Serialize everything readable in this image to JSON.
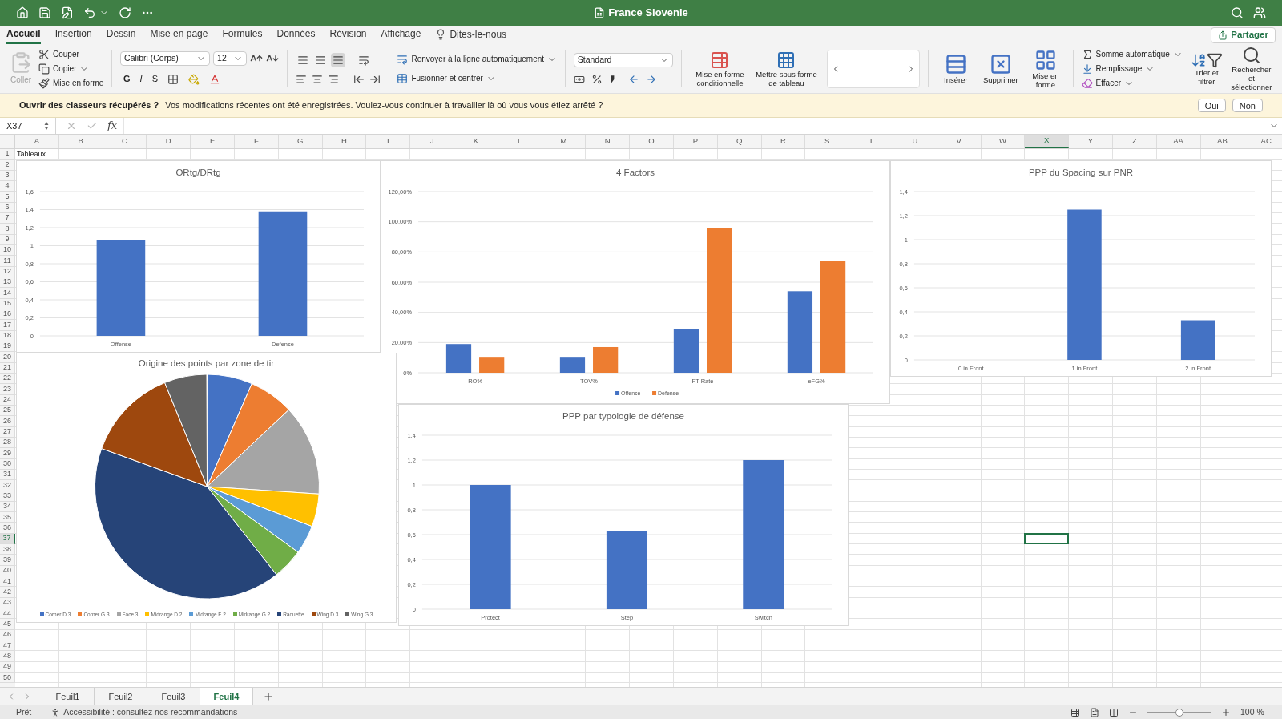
{
  "window": {
    "title": "France Slovenie"
  },
  "menu_tabs": [
    {
      "label": "Accueil",
      "selected": true
    },
    {
      "label": "Insertion",
      "selected": false
    },
    {
      "label": "Dessin",
      "selected": false
    },
    {
      "label": "Mise en page",
      "selected": false
    },
    {
      "label": "Formules",
      "selected": false
    },
    {
      "label": "Données",
      "selected": false
    },
    {
      "label": "Révision",
      "selected": false
    },
    {
      "label": "Affichage",
      "selected": false
    }
  ],
  "tell_me": "Dites-le-nous",
  "share": "Partager",
  "ribbon": {
    "clipboard": {
      "paste": {
        "label": "Coller",
        "disabled": true
      },
      "cut": "Couper",
      "copy": "Copier",
      "format_painter": "Mise en forme"
    },
    "font": {
      "name": "Calibri (Corps)",
      "size": "12",
      "bold": "G",
      "italic": "I",
      "underline": "S"
    },
    "alignment": {
      "vertical": [
        {
          "selected": false
        },
        {
          "selected": false
        },
        {
          "selected": true
        }
      ],
      "wrap": "Renvoyer à la ligne automatiquement",
      "merge": "Fusionner et centrer"
    },
    "number": {
      "format": "Standard"
    },
    "styles": [
      "Mise en forme conditionnelle",
      "Mettre sous forme de tableau"
    ],
    "cells": [
      "Insérer",
      "Supprimer",
      "Mise en forme"
    ],
    "editing": {
      "autosum": "Somme automatique",
      "fill": "Remplissage",
      "clear": "Effacer",
      "sort": "Trier et filtrer",
      "find": "Rechercher et sélectionner"
    }
  },
  "notification": {
    "title": "Ouvrir des classeurs récupérés ?",
    "message": "Vos modifications récentes ont été enregistrées. Voulez-vous continuer à travailler là où vous vous étiez arrêté ?",
    "buttons": [
      "Oui",
      "Non"
    ]
  },
  "formula_bar": {
    "name_box": "X37",
    "function_label": "fx"
  },
  "columns": [
    {
      "label": "A",
      "selected": false
    },
    {
      "label": "B",
      "selected": false
    },
    {
      "label": "C",
      "selected": false
    },
    {
      "label": "D",
      "selected": false
    },
    {
      "label": "E",
      "selected": false
    },
    {
      "label": "F",
      "selected": false
    },
    {
      "label": "G",
      "selected": false
    },
    {
      "label": "H",
      "selected": false
    },
    {
      "label": "I",
      "selected": false
    },
    {
      "label": "J",
      "selected": false
    },
    {
      "label": "K",
      "selected": false
    },
    {
      "label": "L",
      "selected": false
    },
    {
      "label": "M",
      "selected": false
    },
    {
      "label": "N",
      "selected": false
    },
    {
      "label": "O",
      "selected": false
    },
    {
      "label": "P",
      "selected": false
    },
    {
      "label": "Q",
      "selected": false
    },
    {
      "label": "R",
      "selected": false
    },
    {
      "label": "S",
      "selected": false
    },
    {
      "label": "T",
      "selected": false
    },
    {
      "label": "U",
      "selected": false
    },
    {
      "label": "V",
      "selected": false
    },
    {
      "label": "W",
      "selected": false
    },
    {
      "label": "X",
      "selected": true
    },
    {
      "label": "Y",
      "selected": false
    },
    {
      "label": "Z",
      "selected": false
    },
    {
      "label": "AA",
      "selected": false
    },
    {
      "label": "AB",
      "selected": false
    },
    {
      "label": "AC",
      "selected": false
    }
  ],
  "rows": [
    {
      "label": "1",
      "selected": false
    },
    {
      "label": "2",
      "selected": false
    },
    {
      "label": "3",
      "selected": false
    },
    {
      "label": "4",
      "selected": false
    },
    {
      "label": "5",
      "selected": false
    },
    {
      "label": "6",
      "selected": false
    },
    {
      "label": "7",
      "selected": false
    },
    {
      "label": "8",
      "selected": false
    },
    {
      "label": "9",
      "selected": false
    },
    {
      "label": "10",
      "selected": false
    },
    {
      "label": "11",
      "selected": false
    },
    {
      "label": "12",
      "selected": false
    },
    {
      "label": "13",
      "selected": false
    },
    {
      "label": "14",
      "selected": false
    },
    {
      "label": "15",
      "selected": false
    },
    {
      "label": "16",
      "selected": false
    },
    {
      "label": "17",
      "selected": false
    },
    {
      "label": "18",
      "selected": false
    },
    {
      "label": "19",
      "selected": false
    },
    {
      "label": "20",
      "selected": false
    },
    {
      "label": "21",
      "selected": false
    },
    {
      "label": "22",
      "selected": false
    },
    {
      "label": "23",
      "selected": false
    },
    {
      "label": "24",
      "selected": false
    },
    {
      "label": "25",
      "selected": false
    },
    {
      "label": "26",
      "selected": false
    },
    {
      "label": "27",
      "selected": false
    },
    {
      "label": "28",
      "selected": false
    },
    {
      "label": "29",
      "selected": false
    },
    {
      "label": "30",
      "selected": false
    },
    {
      "label": "31",
      "selected": false
    },
    {
      "label": "32",
      "selected": false
    },
    {
      "label": "33",
      "selected": false
    },
    {
      "label": "34",
      "selected": false
    },
    {
      "label": "35",
      "selected": false
    },
    {
      "label": "36",
      "selected": false
    },
    {
      "label": "37",
      "selected": true
    },
    {
      "label": "38",
      "selected": false
    },
    {
      "label": "39",
      "selected": false
    },
    {
      "label": "40",
      "selected": false
    },
    {
      "label": "41",
      "selected": false
    },
    {
      "label": "42",
      "selected": false
    },
    {
      "label": "43",
      "selected": false
    },
    {
      "label": "44",
      "selected": false
    },
    {
      "label": "45",
      "selected": false
    },
    {
      "label": "46",
      "selected": false
    },
    {
      "label": "47",
      "selected": false
    },
    {
      "label": "48",
      "selected": false
    },
    {
      "label": "49",
      "selected": false
    },
    {
      "label": "50",
      "selected": false
    }
  ],
  "cells": [
    {
      "text": "Tableaux"
    }
  ],
  "charts": [
    {
      "kind": "bar",
      "chart_data": {
        "type": "bar",
        "grid": true,
        "title": "ORtg/DRtg",
        "categories": [
          "Offense",
          "Defense"
        ],
        "values": [
          1.06,
          1.38
        ],
        "ylim": [
          0,
          1.6
        ],
        "yticks": [
          {
            "value": 0,
            "label": "0"
          },
          {
            "value": 0.2,
            "label": "0,2"
          },
          {
            "value": 0.4,
            "label": "0,4"
          },
          {
            "value": 0.6,
            "label": "0,6"
          },
          {
            "value": 0.8,
            "label": "0,8"
          },
          {
            "value": 1,
            "label": "1"
          },
          {
            "value": 1.2,
            "label": "1,2"
          },
          {
            "value": 1.4,
            "label": "1,4"
          },
          {
            "value": 1.6,
            "label": "1,6"
          }
        ]
      }
    },
    {
      "kind": "bar",
      "chart_data": {
        "type": "bar",
        "grid": true,
        "legend": "bottom",
        "title": "4 Factors",
        "categories": [
          "RO%",
          "TOV%",
          "FT Rate",
          "eFG%"
        ],
        "series": [
          {
            "name": "Offense",
            "color": "#4472c4",
            "values": [
              0.19,
              0.1,
              0.29,
              0.54
            ]
          },
          {
            "name": "Defense",
            "color": "#ed7d31",
            "values": [
              0.1,
              0.17,
              0.96,
              0.74
            ]
          }
        ],
        "ylim": [
          0,
          1.2
        ],
        "yticks": [
          {
            "value": 0,
            "label": "0%"
          },
          {
            "value": 0.2,
            "label": "20,00%"
          },
          {
            "value": 0.4,
            "label": "40,00%"
          },
          {
            "value": 0.6,
            "label": "60,00%"
          },
          {
            "value": 0.8,
            "label": "80,00%"
          },
          {
            "value": 1,
            "label": "100,00%"
          },
          {
            "value": 1.2,
            "label": "120,00%"
          }
        ]
      }
    },
    {
      "kind": "bar",
      "chart_data": {
        "type": "bar",
        "grid": true,
        "title": "PPP du Spacing sur PNR",
        "categories": [
          "0 in Front",
          "1 in Front",
          "2 in Front"
        ],
        "values": [
          0,
          1.25,
          0.33
        ],
        "ylim": [
          0,
          1.4
        ],
        "yticks": [
          {
            "value": 0,
            "label": "0"
          },
          {
            "value": 0.2,
            "label": "0,2"
          },
          {
            "value": 0.4,
            "label": "0,4"
          },
          {
            "value": 0.6,
            "label": "0,6"
          },
          {
            "value": 0.8,
            "label": "0,8"
          },
          {
            "value": 1,
            "label": "1"
          },
          {
            "value": 1.2,
            "label": "1,2"
          },
          {
            "value": 1.4,
            "label": "1,4"
          }
        ]
      }
    },
    {
      "kind": "pie",
      "title": "Origine des points par zone de tir",
      "legend": [
        {
          "label": "Corner D 3",
          "color": "#4472c4"
        },
        {
          "label": "Corner G 3",
          "color": "#ed7d31"
        },
        {
          "label": "Face 3",
          "color": "#a5a5a5"
        },
        {
          "label": "Midrange D 2",
          "color": "#ffc000"
        },
        {
          "label": "Midrange F 2",
          "color": "#5b9bd5"
        },
        {
          "label": "Midrange G 2",
          "color": "#70ad47"
        },
        {
          "label": "Raquette",
          "color": "#264478"
        },
        {
          "label": "Wing D 3",
          "color": "#9e480e"
        },
        {
          "label": "Wing G 3",
          "color": "#636363"
        }
      ]
    },
    {
      "kind": "bar",
      "chart_data": {
        "type": "bar",
        "grid": true,
        "title": "PPP par typologie de défense",
        "categories": [
          "Protect",
          "Step",
          "Switch"
        ],
        "values": [
          1.0,
          0.63,
          1.2
        ],
        "ylim": [
          0,
          1.4
        ],
        "yticks": [
          {
            "value": 0,
            "label": "0"
          },
          {
            "value": 0.2,
            "label": "0,2"
          },
          {
            "value": 0.4,
            "label": "0,4"
          },
          {
            "value": 0.6,
            "label": "0,6"
          },
          {
            "value": 0.8,
            "label": "0,8"
          },
          {
            "value": 1,
            "label": "1"
          },
          {
            "value": 1.2,
            "label": "1,2"
          },
          {
            "value": 1.4,
            "label": "1,4"
          }
        ]
      }
    }
  ],
  "sheet_tabs": [
    {
      "label": "Feuil1",
      "selected": false
    },
    {
      "label": "Feuil2",
      "selected": false
    },
    {
      "label": "Feuil3",
      "selected": false
    },
    {
      "label": "Feuil4",
      "selected": true
    }
  ],
  "status_bar": {
    "status": "Prêt",
    "accessibility": "Accessibilité : consultez nos recommandations",
    "zoom": {
      "label": "100 %",
      "level": 0.5
    }
  }
}
